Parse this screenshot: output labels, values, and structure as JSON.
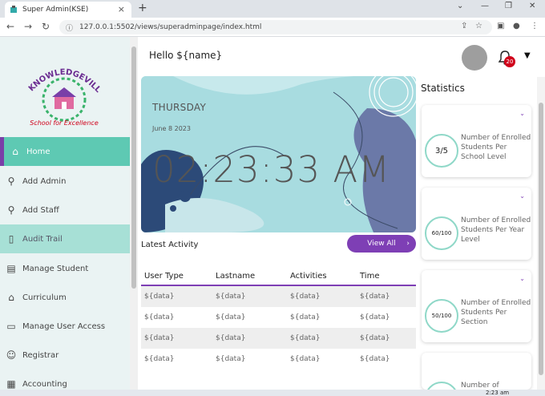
{
  "browser": {
    "tab_title": "Super Admin(KSE)",
    "url": "127.0.0.1:5502/views/superadminpage/index.html"
  },
  "sidebar": {
    "logo_text_top": "KNOWLEDGEVILLE",
    "logo_text_bottom": "School for Excellence",
    "items": [
      {
        "label": "Home",
        "icon": "home-icon"
      },
      {
        "label": "Add Admin",
        "icon": "add-user-icon"
      },
      {
        "label": "Add Staff",
        "icon": "add-user-icon"
      },
      {
        "label": "Audit Trail",
        "icon": "document-icon"
      },
      {
        "label": "Manage Student",
        "icon": "id-card-icon"
      },
      {
        "label": "Curriculum",
        "icon": "graduation-cap-icon"
      },
      {
        "label": "Manage User Access",
        "icon": "monitor-icon"
      },
      {
        "label": "Registrar",
        "icon": "person-icon"
      },
      {
        "label": "Accounting",
        "icon": "calculator-icon"
      }
    ]
  },
  "header": {
    "greeting": "Hello ${name}",
    "notification_count": "20"
  },
  "clock": {
    "day": "THURSDAY",
    "date": "June 8 2023",
    "time": "02:23:33 AM"
  },
  "activity": {
    "title": "Latest Activity",
    "view_all": "View All",
    "columns": [
      "User Type",
      "Lastname",
      "Activities",
      "Time"
    ],
    "rows": [
      [
        "${data}",
        "${data}",
        "${data}",
        "${data}"
      ],
      [
        "${data}",
        "${data}",
        "${data}",
        "${data}"
      ],
      [
        "${data}",
        "${data}",
        "${data}",
        "${data}"
      ],
      [
        "${data}",
        "${data}",
        "${data}",
        "${data}"
      ]
    ]
  },
  "statistics": {
    "title": "Statistics",
    "cards": [
      {
        "value": "3/5",
        "label": "Number of Enrolled Students Per School Level"
      },
      {
        "value": "60/100",
        "label": "Number of Enrolled Students Per Year Level"
      },
      {
        "value": "50/100",
        "label": "Number of Enrolled Students Per Section"
      },
      {
        "value": "",
        "label": "Number of"
      }
    ]
  },
  "taskbar": {
    "time": "2:23 am"
  },
  "colors": {
    "accent_teal": "#5ec9b3",
    "accent_purple": "#7e3fb5",
    "badge_red": "#d0021b"
  }
}
